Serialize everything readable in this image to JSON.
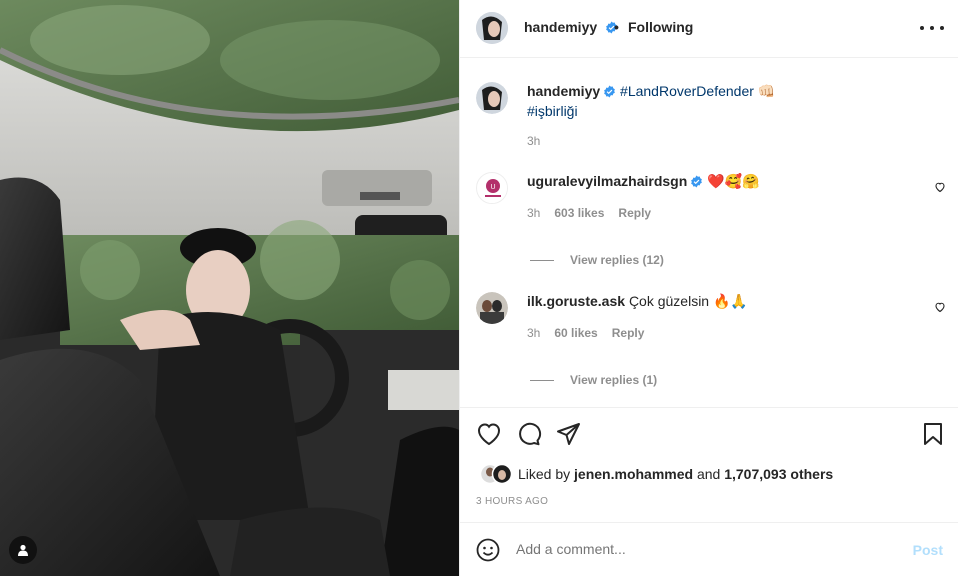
{
  "post": {
    "author": "handemiyy",
    "follow_status": "Following",
    "separator": "•"
  },
  "caption": {
    "username": "handemiyy",
    "hashtag1": "#LandRoverDefender",
    "hashtag2": "#işbirliği",
    "emoji": "👊🏻",
    "time": "3h"
  },
  "comments": [
    {
      "username": "uguralevyilmazhairdsgn",
      "verified": true,
      "text": "❤️🥰🤗",
      "time": "3h",
      "likes": "603 likes",
      "reply": "Reply",
      "view_replies": "View replies (12)"
    },
    {
      "username": "ilk.goruste.ask",
      "verified": false,
      "text": "Çok güzelsin 🔥🙏",
      "time": "3h",
      "likes": "60 likes",
      "reply": "Reply",
      "view_replies": "View replies (1)"
    }
  ],
  "likes": {
    "prefix": "Liked by",
    "user": "jenen.mohammed",
    "conj": "and",
    "count": "1,707,093 others"
  },
  "timestamp": "3 HOURS AGO",
  "add_comment": {
    "placeholder": "Add a comment...",
    "post_label": "Post"
  },
  "icons": {
    "verified": "verified-badge-icon",
    "more": "more-options-icon",
    "like": "heart-icon",
    "comment": "comment-icon",
    "share": "share-icon",
    "save": "bookmark-icon",
    "emoji": "emoji-icon",
    "tagged_user": "user-tag-icon"
  },
  "colors": {
    "verified_blue": "#3897f0",
    "hashtag": "#00376b",
    "muted": "#8e8e8e",
    "post_disabled": "#b2dffc"
  }
}
